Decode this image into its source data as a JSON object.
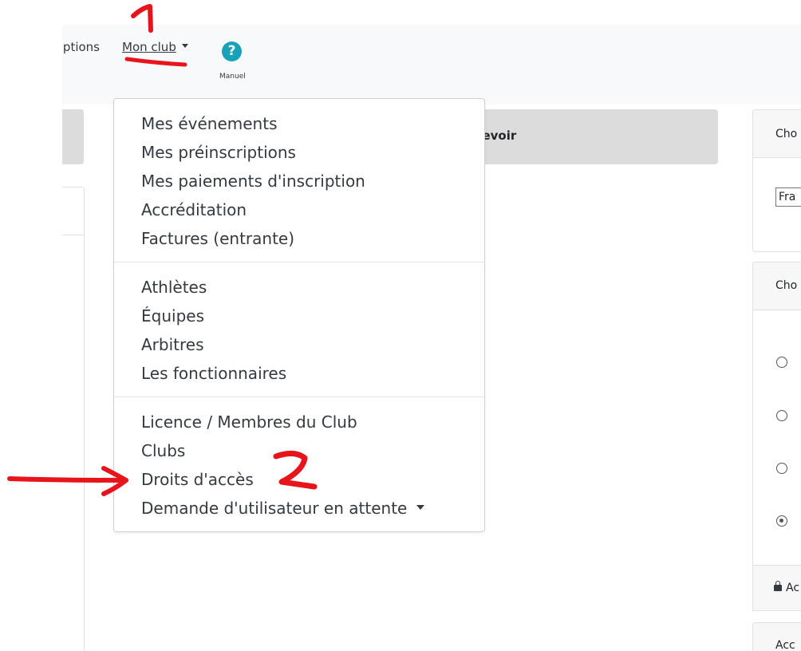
{
  "navbar": {
    "inscriptions_label": "Inscriptions",
    "monclub_label": "Mon club",
    "manual_label": "Manuel"
  },
  "main": {
    "header_text": "Devoir"
  },
  "dropdown": {
    "items": [
      "Mes événements",
      "Mes préinscriptions",
      "Mes paiements d'inscription",
      "Accréditation",
      "Factures (entrante)",
      "Athlètes",
      "Équipes",
      "Arbitres",
      "Les fonctionnaires",
      "Licence / Membres du Club",
      "Clubs",
      "Droits d'accès",
      "Demande d'utilisateur en attente"
    ]
  },
  "right": {
    "card1_title": "Cho",
    "language_value": "Fra",
    "card2_title": "Cho",
    "access_label": "Ac",
    "card3_title": "Acc"
  },
  "annotations": {
    "step1": "1",
    "step2": "2"
  },
  "colors": {
    "help_icon": "#17a2b8",
    "annotation_red": "#e8141c",
    "navbar_bg": "#f8f9fa",
    "gray_bar": "#dcdcdc"
  }
}
